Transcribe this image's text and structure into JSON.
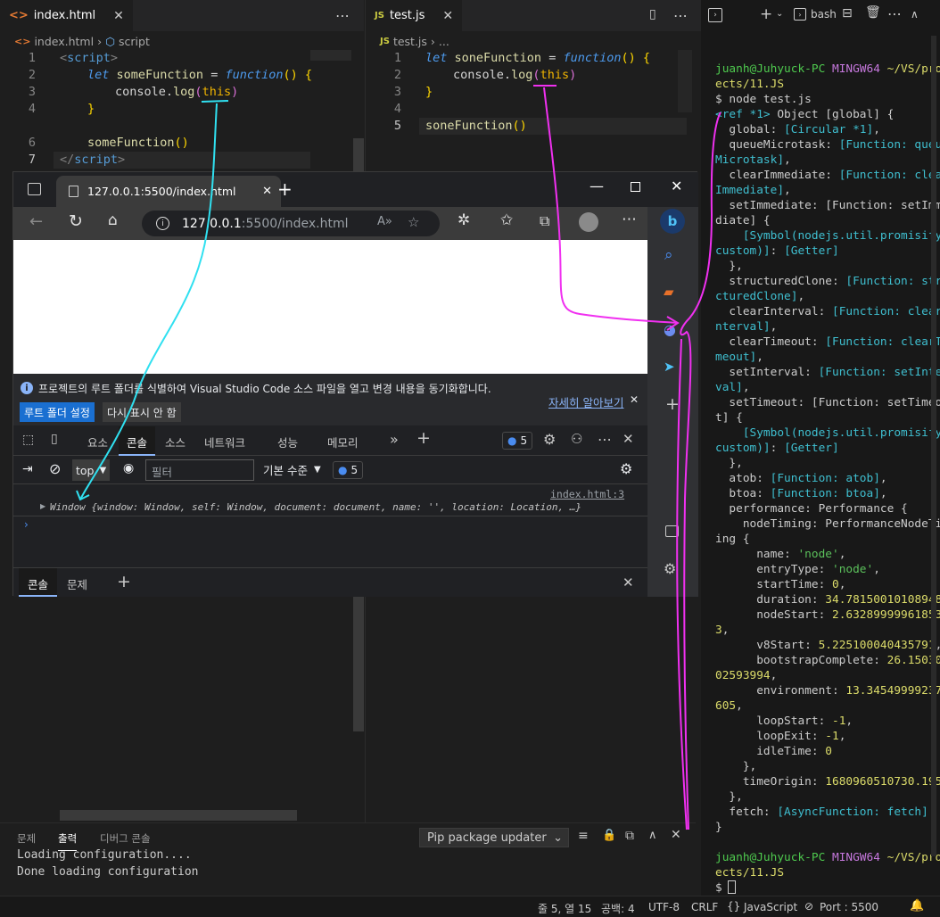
{
  "left_editor": {
    "tab_label": "index.html",
    "crumbs": [
      "index.html",
      "script"
    ],
    "line_numbers": [
      "1",
      "2",
      "3",
      "4",
      "5",
      "6",
      "7"
    ],
    "code": {
      "l1_open": "<",
      "l1_tag": "script",
      "l1_close": ">",
      "l2_kw": "let",
      "l2_name": "someFunction",
      "l2_eq": " = ",
      "l2_fn": "function",
      "l2_rest": "()",
      "l2_brace": " {",
      "l3_obj": "console.",
      "l3_fn": "log",
      "l3_p1": "(",
      "l3_this": "this",
      "l3_p2": ")",
      "l4_brace": "}",
      "l6_call": "someFunction",
      "l6_parens": "()",
      "l7_open": "</",
      "l7_tag": "script",
      "l7_close": ">"
    }
  },
  "right_editor": {
    "tab_label": "test.js",
    "crumbs": [
      "test.js",
      "..."
    ],
    "line_numbers": [
      "1",
      "2",
      "3",
      "4",
      "5"
    ],
    "code": {
      "l1_kw": "let",
      "l1_name": "soneFunction",
      "l1_eq": " = ",
      "l1_fn": "function",
      "l1_rest": "()",
      "l1_brace": " {",
      "l2_obj": "console.",
      "l2_fn": "log",
      "l2_p1": "(",
      "l2_this": "this",
      "l2_p2": ")",
      "l3_brace": "}",
      "l5_call": "soneFunction",
      "l5_parens": "()"
    }
  },
  "terminal": {
    "shell_label": "bash",
    "lines": [
      {
        "segs": [
          {
            "t": "juanh@Juhyuck-PC ",
            "c": "gn"
          },
          {
            "t": "MINGW64 ",
            "c": "mag"
          },
          {
            "t": "~/VS/proj",
            "c": "yel"
          }
        ]
      },
      {
        "segs": [
          {
            "t": "ects/11.JS",
            "c": "yel"
          }
        ]
      },
      {
        "segs": [
          {
            "t": "$ node test.js",
            "c": ""
          }
        ]
      },
      {
        "segs": [
          {
            "t": "<ref *1> ",
            "c": "cy"
          },
          {
            "t": "Object [global] {",
            "c": ""
          }
        ]
      },
      {
        "segs": [
          {
            "t": "  global: ",
            "c": ""
          },
          {
            "t": "[Circular *1]",
            "c": "cy"
          },
          {
            "t": ",",
            "c": ""
          }
        ]
      },
      {
        "segs": [
          {
            "t": "  queueMicrotask: ",
            "c": ""
          },
          {
            "t": "[Function: queue",
            "c": "cy"
          }
        ]
      },
      {
        "segs": [
          {
            "t": "Microtask]",
            "c": "cy"
          },
          {
            "t": ",",
            "c": ""
          }
        ]
      },
      {
        "segs": [
          {
            "t": "  clearImmediate: ",
            "c": ""
          },
          {
            "t": "[Function: clear",
            "c": "cy"
          }
        ]
      },
      {
        "segs": [
          {
            "t": "Immediate]",
            "c": "cy"
          },
          {
            "t": ",",
            "c": ""
          }
        ]
      },
      {
        "segs": [
          {
            "t": "  setImmediate: [Function: setImme",
            "c": ""
          }
        ]
      },
      {
        "segs": [
          {
            "t": "diate] {",
            "c": ""
          }
        ]
      },
      {
        "segs": [
          {
            "t": "    [Symbol(nodejs.util.promisify.",
            "c": "cy"
          }
        ]
      },
      {
        "segs": [
          {
            "t": "custom)]",
            "c": "cy"
          },
          {
            "t": ": ",
            "c": ""
          },
          {
            "t": "[Getter]",
            "c": "cy"
          }
        ]
      },
      {
        "segs": [
          {
            "t": "  },",
            "c": ""
          }
        ]
      },
      {
        "segs": [
          {
            "t": "  structuredClone: ",
            "c": ""
          },
          {
            "t": "[Function: stru",
            "c": "cy"
          }
        ]
      },
      {
        "segs": [
          {
            "t": "cturedClone]",
            "c": "cy"
          },
          {
            "t": ",",
            "c": ""
          }
        ]
      },
      {
        "segs": [
          {
            "t": "  clearInterval: ",
            "c": ""
          },
          {
            "t": "[Function: clearI",
            "c": "cy"
          }
        ]
      },
      {
        "segs": [
          {
            "t": "nterval]",
            "c": "cy"
          },
          {
            "t": ",",
            "c": ""
          }
        ]
      },
      {
        "segs": [
          {
            "t": "  clearTimeout: ",
            "c": ""
          },
          {
            "t": "[Function: clearTi",
            "c": "cy"
          }
        ]
      },
      {
        "segs": [
          {
            "t": "meout]",
            "c": "cy"
          },
          {
            "t": ",",
            "c": ""
          }
        ]
      },
      {
        "segs": [
          {
            "t": "  setInterval: ",
            "c": ""
          },
          {
            "t": "[Function: setInter",
            "c": "cy"
          }
        ]
      },
      {
        "segs": [
          {
            "t": "val]",
            "c": "cy"
          },
          {
            "t": ",",
            "c": ""
          }
        ]
      },
      {
        "segs": [
          {
            "t": "  setTimeout: [Function: setTimeou",
            "c": ""
          }
        ]
      },
      {
        "segs": [
          {
            "t": "t] {",
            "c": ""
          }
        ]
      },
      {
        "segs": [
          {
            "t": "    [Symbol(nodejs.util.promisify.",
            "c": "cy"
          }
        ]
      },
      {
        "segs": [
          {
            "t": "custom)]",
            "c": "cy"
          },
          {
            "t": ": ",
            "c": ""
          },
          {
            "t": "[Getter]",
            "c": "cy"
          }
        ]
      },
      {
        "segs": [
          {
            "t": "  },",
            "c": ""
          }
        ]
      },
      {
        "segs": [
          {
            "t": "  atob: ",
            "c": ""
          },
          {
            "t": "[Function: atob]",
            "c": "cy"
          },
          {
            "t": ",",
            "c": ""
          }
        ]
      },
      {
        "segs": [
          {
            "t": "  btoa: ",
            "c": ""
          },
          {
            "t": "[Function: btoa]",
            "c": "cy"
          },
          {
            "t": ",",
            "c": ""
          }
        ]
      },
      {
        "segs": [
          {
            "t": "  performance: Performance {",
            "c": ""
          }
        ]
      },
      {
        "segs": [
          {
            "t": "    nodeTiming: PerformanceNodeTim",
            "c": ""
          }
        ]
      },
      {
        "segs": [
          {
            "t": "ing {",
            "c": ""
          }
        ]
      },
      {
        "segs": [
          {
            "t": "      name: ",
            "c": ""
          },
          {
            "t": "'node'",
            "c": "gr"
          },
          {
            "t": ",",
            "c": ""
          }
        ]
      },
      {
        "segs": [
          {
            "t": "      entryType: ",
            "c": ""
          },
          {
            "t": "'node'",
            "c": "gr"
          },
          {
            "t": ",",
            "c": ""
          }
        ]
      },
      {
        "segs": [
          {
            "t": "      startTime: ",
            "c": ""
          },
          {
            "t": "0",
            "c": "yel"
          },
          {
            "t": ",",
            "c": ""
          }
        ]
      },
      {
        "segs": [
          {
            "t": "      duration: ",
            "c": ""
          },
          {
            "t": "34.78150010108948",
            "c": "yel"
          },
          {
            "t": ",",
            "c": ""
          }
        ]
      },
      {
        "segs": [
          {
            "t": "      nodeStart: ",
            "c": ""
          },
          {
            "t": "2.632899999618530",
            "c": "yel"
          }
        ]
      },
      {
        "segs": [
          {
            "t": "3",
            "c": "yel"
          },
          {
            "t": ",",
            "c": ""
          }
        ]
      },
      {
        "segs": [
          {
            "t": "      v8Start: ",
            "c": ""
          },
          {
            "t": "5.225100040435791",
            "c": "yel"
          },
          {
            "t": ",",
            "c": ""
          }
        ]
      },
      {
        "segs": [
          {
            "t": "      bootstrapComplete: ",
            "c": ""
          },
          {
            "t": "26.150300",
            "c": "yel"
          }
        ]
      },
      {
        "segs": [
          {
            "t": "02593994",
            "c": "yel"
          },
          {
            "t": ",",
            "c": ""
          }
        ]
      },
      {
        "segs": [
          {
            "t": "      environment: ",
            "c": ""
          },
          {
            "t": "13.345499992370",
            "c": "yel"
          }
        ]
      },
      {
        "segs": [
          {
            "t": "605",
            "c": "yel"
          },
          {
            "t": ",",
            "c": ""
          }
        ]
      },
      {
        "segs": [
          {
            "t": "      loopStart: ",
            "c": ""
          },
          {
            "t": "-1",
            "c": "yel"
          },
          {
            "t": ",",
            "c": ""
          }
        ]
      },
      {
        "segs": [
          {
            "t": "      loopExit: ",
            "c": ""
          },
          {
            "t": "-1",
            "c": "yel"
          },
          {
            "t": ",",
            "c": ""
          }
        ]
      },
      {
        "segs": [
          {
            "t": "      idleTime: ",
            "c": ""
          },
          {
            "t": "0",
            "c": "yel"
          }
        ]
      },
      {
        "segs": [
          {
            "t": "    },",
            "c": ""
          }
        ]
      },
      {
        "segs": [
          {
            "t": "    timeOrigin: ",
            "c": ""
          },
          {
            "t": "1680960510730.195",
            "c": "yel"
          }
        ]
      },
      {
        "segs": [
          {
            "t": "  },",
            "c": ""
          }
        ]
      },
      {
        "segs": [
          {
            "t": "  fetch: ",
            "c": ""
          },
          {
            "t": "[AsyncFunction: fetch]",
            "c": "cy"
          }
        ]
      },
      {
        "segs": [
          {
            "t": "}",
            "c": ""
          }
        ]
      },
      {
        "segs": [
          {
            "t": "",
            "c": ""
          }
        ]
      },
      {
        "segs": [
          {
            "t": "juanh@Juhyuck-PC ",
            "c": "gn"
          },
          {
            "t": "MINGW64 ",
            "c": "mag"
          },
          {
            "t": "~/VS/proj",
            "c": "yel"
          }
        ]
      },
      {
        "segs": [
          {
            "t": "ects/11.JS",
            "c": "yel"
          }
        ]
      },
      {
        "segs": [
          {
            "t": "$ ",
            "c": ""
          }
        ]
      }
    ]
  },
  "browser": {
    "tab_title": "127.0.0.1:5500/index.html",
    "url_host": "127.0.0.1",
    "url_rest": ":5500/index.html",
    "infobar": {
      "message": "프로젝트의 루트 폴더를 식별하여 Visual Studio Code 소스 파일을 열고 변경 내용을 동기화합니다.",
      "primary": "루트 폴더 설정",
      "secondary": "다시 표시 안 함",
      "link": "자세히 알아보기"
    },
    "devtools": {
      "tabs": [
        "요소",
        "콘솔",
        "소스",
        "네트워크",
        "성능",
        "메모리"
      ],
      "active_tab": "콘솔",
      "issues_count": "5",
      "context": "top",
      "filter_placeholder": "필터",
      "level": "기본 수준",
      "level_count": "5",
      "log_source": "index.html:3",
      "log_text": "Window {window: Window, self: Window, document: document, name: '', location: Location, …}",
      "drawer_tabs": [
        "콘솔",
        "문제"
      ]
    }
  },
  "panel": {
    "tabs": [
      "문제",
      "출력",
      "디버그 콘솔"
    ],
    "active": "출력",
    "channel": "Pip package updater",
    "lines": [
      "Loading configuration....",
      "Done loading configuration"
    ]
  },
  "statusbar": {
    "position": "줄 5, 열 15",
    "spaces": "공백: 4",
    "encoding": "UTF-8",
    "eol": "CRLF",
    "language": "JavaScript",
    "port": "Port : 5500"
  },
  "colors": {
    "annotation_cyan": "#30e0f0",
    "annotation_magenta": "#f030f0"
  }
}
